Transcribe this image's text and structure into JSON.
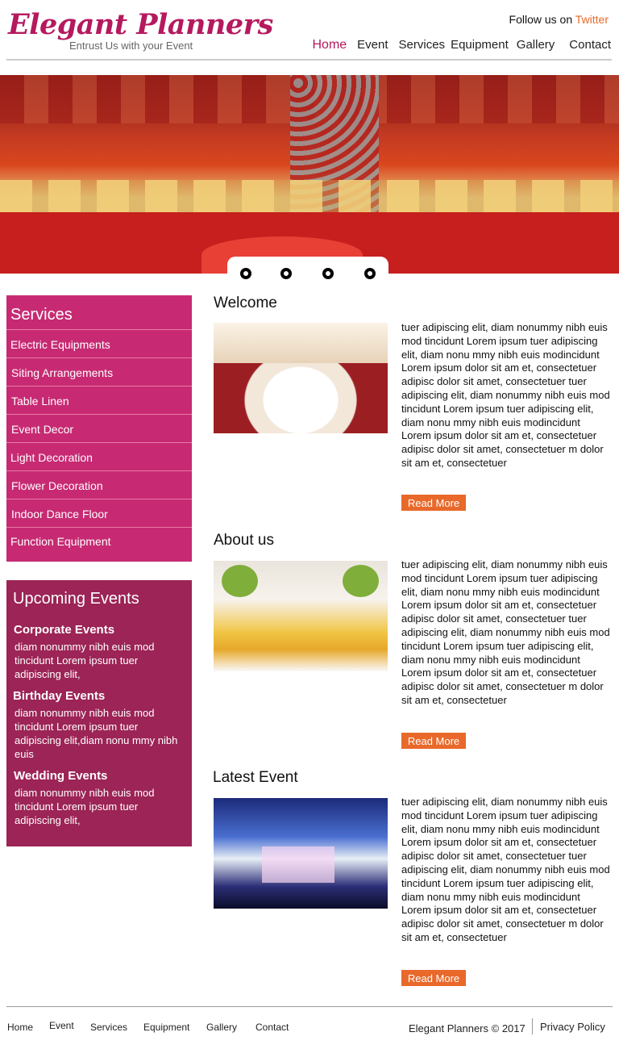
{
  "header": {
    "logo_title": "Elegant Planners",
    "logo_tagline": "Entrust Us with your Event",
    "follow_text": "Follow us on",
    "follow_link": "Twitter",
    "nav": [
      "Home",
      "Event",
      "Services",
      "Equipment",
      "Gallery",
      "Contact"
    ],
    "active_nav": "Home"
  },
  "hero": {
    "slides": 4
  },
  "sidebar": {
    "services_title": "Services",
    "services": [
      "Electric Equipments",
      "Siting Arrangements",
      "Table Linen",
      "Event Decor",
      "Light Decoration",
      "Flower Decoration",
      "Indoor Dance Floor",
      "Function Equipment"
    ],
    "events_title": "Upcoming Events",
    "events": [
      {
        "title": "Corporate Events",
        "text": "diam nonummy nibh euis mod tincidunt Lorem ipsum tuer adipiscing elit,"
      },
      {
        "title": "Birthday Events",
        "text": "diam nonummy nibh euis mod tincidunt Lorem ipsum tuer adipiscing elit,diam nonu mmy nibh euis"
      },
      {
        "title": "Wedding Events",
        "text": "diam nonummy nibh euis mod tincidunt Lorem ipsum tuer adipiscing elit,"
      }
    ]
  },
  "main": {
    "sections": [
      {
        "title": "Welcome",
        "text": "tuer adipiscing elit, diam nonummy nibh euis mod tincidunt Lorem ipsum tuer adipiscing elit, diam nonu mmy nibh euis modincidunt Lorem ipsum dolor sit am et, consectetuer adipisc dolor sit amet, consectetuer tuer adipiscing elit, diam nonummy nibh euis mod tincidunt Lorem ipsum tuer adipiscing elit, diam nonu mmy nibh euis modincidunt Lorem ipsum dolor sit am et, consectetuer adipisc dolor sit amet, consectetuer m dolor sit am et, consectetuer",
        "button": "Read More"
      },
      {
        "title": "About us",
        "text": "tuer adipiscing elit, diam nonummy nibh euis mod tincidunt Lorem ipsum tuer adipiscing elit, diam nonu mmy nibh euis modincidunt Lorem ipsum dolor sit am et, consectetuer adipisc dolor sit amet, consectetuer tuer adipiscing elit, diam nonummy nibh euis mod tincidunt Lorem ipsum tuer adipiscing elit, diam nonu mmy nibh euis modincidunt Lorem ipsum dolor sit am et, consectetuer adipisc dolor sit amet, consectetuer m dolor sit am et, consectetuer",
        "button": "Read More"
      },
      {
        "title": "Latest Event",
        "text": "tuer adipiscing elit, diam nonummy nibh euis mod tincidunt Lorem ipsum tuer adipiscing elit, diam nonu mmy nibh euis modincidunt Lorem ipsum dolor sit am et, consectetuer adipisc dolor sit amet, consectetuer tuer adipiscing elit, diam nonummy nibh euis mod tincidunt Lorem ipsum tuer adipiscing elit, diam nonu mmy nibh euis modincidunt Lorem ipsum dolor sit am et, consectetuer adipisc dolor sit amet, consectetuer m dolor sit am et, consectetuer",
        "button": "Read More"
      }
    ]
  },
  "footer": {
    "nav": [
      "Home",
      "Event",
      "Services",
      "Equipment",
      "Gallery",
      "Contact"
    ],
    "copyright": "Elegant Planners © 2017",
    "privacy": "Privacy Policy"
  },
  "colors": {
    "brand": "#b5195e",
    "services_bg": "#c72a73",
    "events_bg": "#9c2456",
    "accent": "#e8692a"
  }
}
